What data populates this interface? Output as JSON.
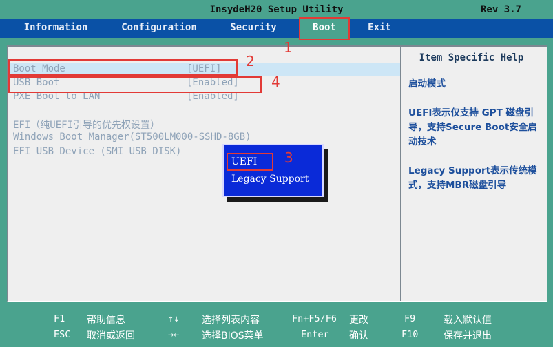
{
  "title": "InsydeH20 Setup Utility",
  "revision": "Rev 3.7",
  "tabs": [
    {
      "label": "Information"
    },
    {
      "label": "Configuration"
    },
    {
      "label": "Security"
    },
    {
      "label": "Boot"
    },
    {
      "label": "Exit"
    }
  ],
  "boot_items": [
    {
      "label": "Boot Mode",
      "value": "[UEFI]"
    },
    {
      "label": "USB Boot",
      "value": "[Enabled]"
    },
    {
      "label": "PXE Boot to LAN",
      "value": "[Enabled]"
    }
  ],
  "efi_section": {
    "header": "EFI（纯UEFI引导的优先权设置）",
    "entries": [
      "Windows Boot Manager(ST500LM000-SSHD-8GB)",
      "EFI USB Device (SMI USB DISK)"
    ]
  },
  "popup": {
    "options": [
      "UEFI",
      "Legacy Support"
    ]
  },
  "help": {
    "title": "Item Specific Help",
    "lines": [
      "启动模式",
      "UEFI表示仅支持 GPT 磁盘引导，支持Secure Boot安全启动技术",
      "Legacy Support表示传统模式，支持MBR磁盘引导"
    ]
  },
  "annotations": [
    "1",
    "2",
    "3",
    "4"
  ],
  "footer": [
    {
      "key": "F1",
      "desc": "帮助信息"
    },
    {
      "key": "ESC",
      "desc": "取消或返回"
    },
    {
      "key": "↑↓",
      "desc": "选择列表内容"
    },
    {
      "key": "→←",
      "desc": "选择BIOS菜单"
    },
    {
      "key": "Fn+F5/F6",
      "desc": "更改"
    },
    {
      "key": "Enter",
      "desc": "确认"
    },
    {
      "key": "F9",
      "desc": "载入默认值"
    },
    {
      "key": "F10",
      "desc": "保存并退出"
    }
  ],
  "colors": {
    "background": "#4aa38e",
    "menubar": "#0a51a6",
    "popup": "#0a2ad8",
    "annotation": "#e23a36",
    "help_text": "#1d4f9c"
  }
}
